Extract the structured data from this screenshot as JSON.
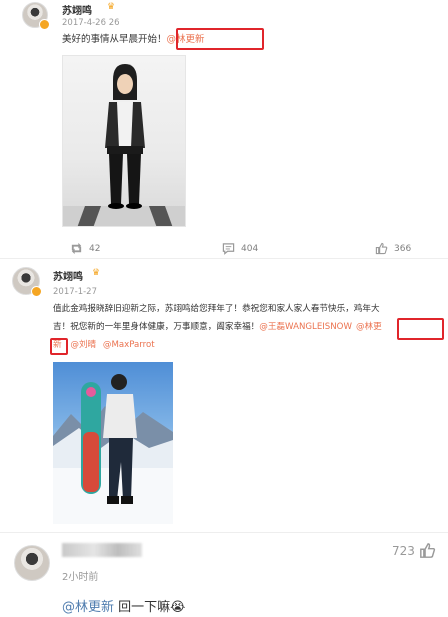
{
  "post1": {
    "author": "苏翊鸣",
    "time": "2017-4-26 26",
    "text": "美好的事情从早晨开始！",
    "mention": "@林更新",
    "actions": {
      "repost": "42",
      "comment": "404",
      "like": "366"
    }
  },
  "post2": {
    "author": "苏翊鸣",
    "time": "2017-1-27",
    "text_line1": "值此金鸡报晓辞旧迎新之际，苏翊鸣给您拜年了！恭祝您和家人家人春节快乐，鸡年大",
    "text_line2": "吉！祝您新的一年里身体健康，万事顺意，阖家幸福！",
    "mention_wang": "@王磊WANGLEISNOW",
    "mention_lin_part1": "@林更",
    "mention_lin_part2": "新",
    "mention_liu": "@刘晴",
    "mention_max": "@MaxParrot"
  },
  "comment": {
    "time": "2小时前",
    "likes": "723",
    "mention": "@林更新",
    "text": " 回一下嘛",
    "emoji": "😭"
  },
  "icons": [
    "crown-icon",
    "verified-badge-icon",
    "repost-icon",
    "comment-icon",
    "like-icon"
  ],
  "colors": {
    "mention": "#eb7350",
    "highlight_box": "#e0252b",
    "badge": "#f5a623"
  }
}
